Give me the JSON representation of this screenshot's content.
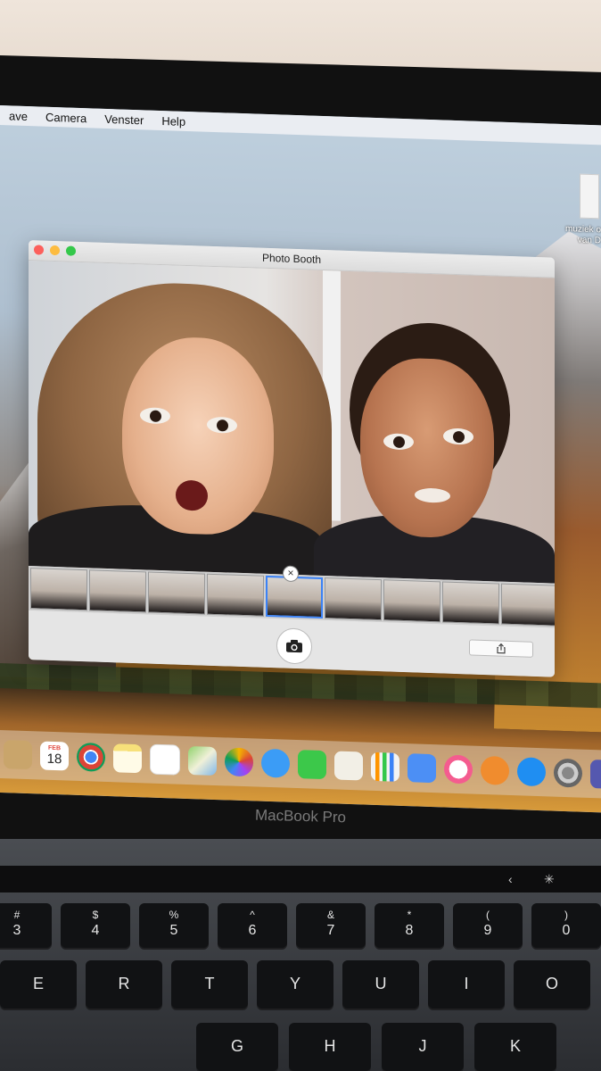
{
  "menubar": {
    "items": [
      "ave",
      "Camera",
      "Venster",
      "Help"
    ]
  },
  "desktop": {
    "folder_label": "muziek o van D"
  },
  "window": {
    "title": "Photo Booth"
  },
  "filmstrip": {
    "thumb_count": 9,
    "selected_index": 4
  },
  "dock": {
    "calendar_month": "FEB",
    "calendar_day": "18",
    "apps": [
      "Finder",
      "Calendar",
      "Chrome",
      "Notes",
      "Reminders",
      "Maps",
      "Photos",
      "Messages",
      "FaceTime",
      "Pages",
      "Numbers",
      "Keynote",
      "iTunes",
      "iBooks",
      "App Store",
      "System Preferences",
      "Teams"
    ]
  },
  "laptop": {
    "model": "MacBook Pro"
  },
  "keyboard": {
    "row1": [
      {
        "top": "#",
        "main": "3"
      },
      {
        "top": "$",
        "main": "4"
      },
      {
        "top": "%",
        "main": "5"
      },
      {
        "top": "^",
        "main": "6"
      },
      {
        "top": "&",
        "main": "7"
      },
      {
        "top": "*",
        "main": "8"
      },
      {
        "top": "(",
        "main": "9"
      },
      {
        "top": ")",
        "main": "0"
      }
    ],
    "row2": [
      "E",
      "R",
      "T",
      "Y",
      "U",
      "I",
      "O"
    ],
    "row3": [
      "G",
      "H",
      "J",
      "K"
    ]
  },
  "colors": {
    "traffic_red": "#fc605c",
    "traffic_yellow": "#fdbc40",
    "traffic_green": "#34c84a",
    "selection_blue": "#3b82f6"
  }
}
